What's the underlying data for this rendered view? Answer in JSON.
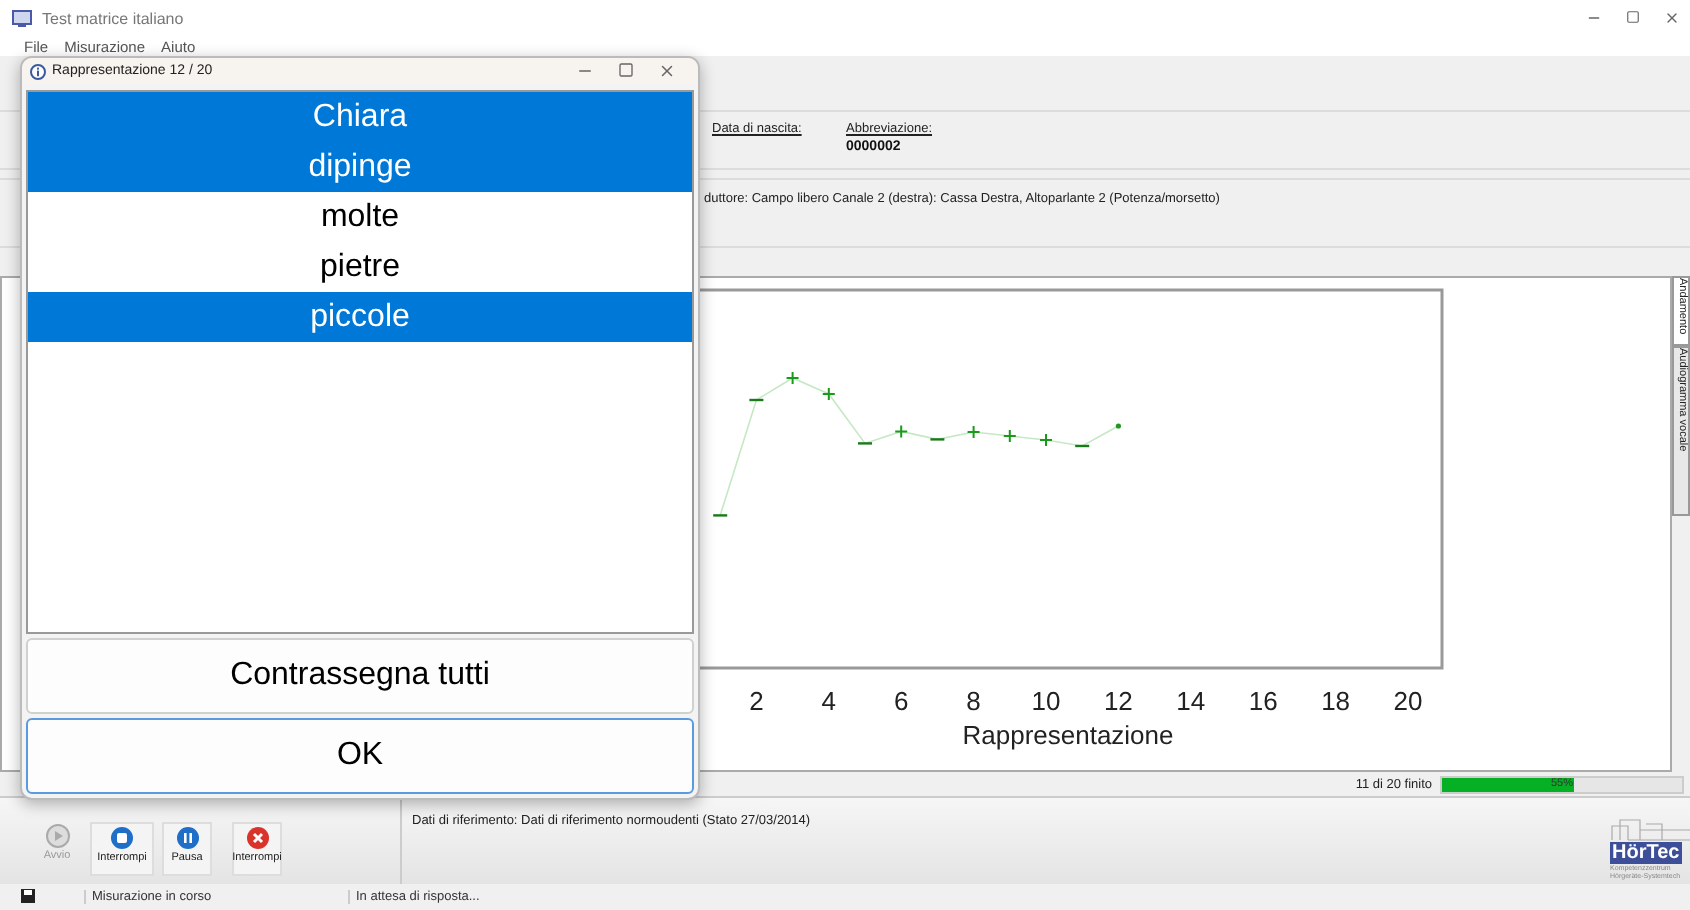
{
  "window": {
    "title": "Test matrice italiano"
  },
  "menu": [
    "File",
    "Misurazione",
    "Aiuto"
  ],
  "patient": {
    "fields": [
      {
        "label": "Data di nascita:"
      },
      {
        "label": "Abbreviazione:",
        "value": "0000002"
      }
    ]
  },
  "device_line": "duttore: Campo libero  Canale 2 (destra): Cassa Destra, Altoparlante 2 (Potenza/morsetto)",
  "chart": {
    "x_ticks": [
      "2",
      "4",
      "6",
      "8",
      "10",
      "12",
      "14",
      "16",
      "18",
      "20"
    ],
    "xlabel": "Rappresentazione"
  },
  "side_tabs": [
    {
      "label": "Andamento",
      "selected": true
    },
    {
      "label": "Audiogramma vocale",
      "selected": false
    }
  ],
  "progress": {
    "text": "11 di 20 finito",
    "level": 0.55,
    "reading": "55%"
  },
  "toolbar": [
    {
      "label": "Avvio",
      "kind": "start",
      "disabled": true
    },
    {
      "label": "Interrompi",
      "kind": "stop",
      "disabled": false
    },
    {
      "label": "Pausa",
      "kind": "pause",
      "disabled": false
    },
    {
      "label": "Interrompi",
      "kind": "cancel",
      "disabled": false
    }
  ],
  "reference": "Dati di riferimento: Dati di riferimento normoudenti (Stato 27/03/2014)",
  "logo": {
    "name": "HörTec",
    "subtitle": [
      "Kompetenzzentrum",
      "Hörgeräte-Systemtech"
    ]
  },
  "status_bar": [
    "Misurazione in corso",
    "In attesa di risposta..."
  ],
  "dialog": {
    "title": "Rappresentazione 12 / 20",
    "words": [
      {
        "text": "Chiara",
        "selected": true
      },
      {
        "text": "dipinge",
        "selected": true
      },
      {
        "text": "molte",
        "selected": false
      },
      {
        "text": "pietre",
        "selected": false
      },
      {
        "text": "piccole",
        "selected": true
      }
    ],
    "buttons": [
      {
        "label": "Contrassegna tutti",
        "focused": false
      },
      {
        "label": "OK",
        "focused": true
      }
    ]
  }
}
